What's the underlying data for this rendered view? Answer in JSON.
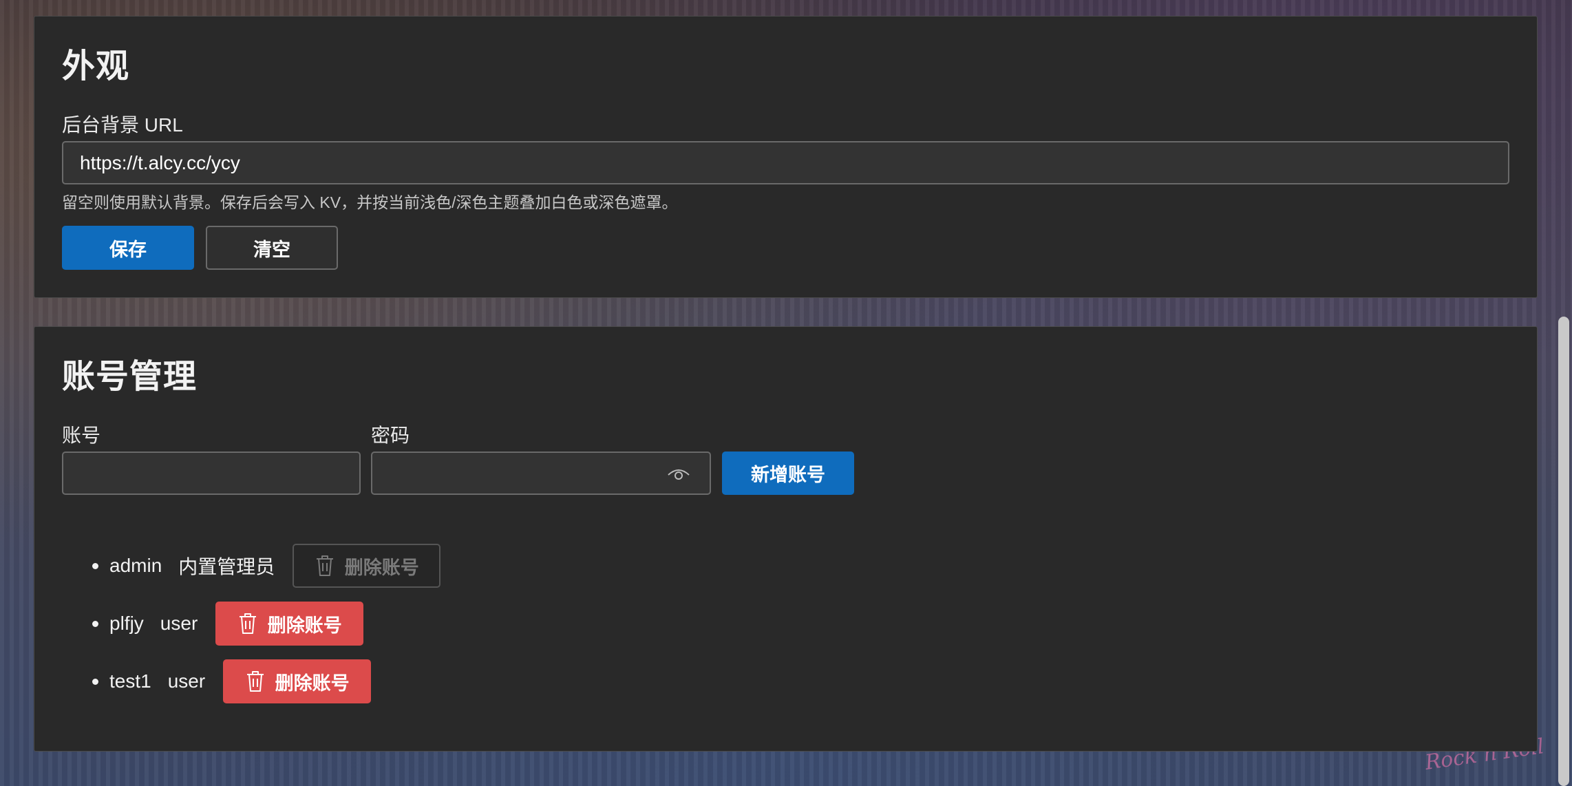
{
  "appearance": {
    "title": "外观",
    "bg_url_label": "后台背景 URL",
    "bg_url_value": "https://t.alcy.cc/ycy",
    "hint": "留空则使用默认背景。保存后会写入 KV，并按当前浅色/深色主题叠加白色或深色遮罩。",
    "save_label": "保存",
    "clear_label": "清空"
  },
  "accounts": {
    "title": "账号管理",
    "username_label": "账号",
    "username_value": "",
    "password_label": "密码",
    "password_value": "",
    "add_label": "新增账号",
    "list": [
      {
        "name": "admin",
        "role": "内置管理员",
        "delete_label": "删除账号",
        "deletable": false
      },
      {
        "name": "plfjy",
        "role": "user",
        "delete_label": "删除账号",
        "deletable": true
      },
      {
        "name": "test1",
        "role": "user",
        "delete_label": "删除账号",
        "deletable": true
      }
    ]
  },
  "background_watermark": "Rock n Roll",
  "colors": {
    "panel": "#292929",
    "primary": "#0f6cbd",
    "danger": "#dc4b4b"
  }
}
